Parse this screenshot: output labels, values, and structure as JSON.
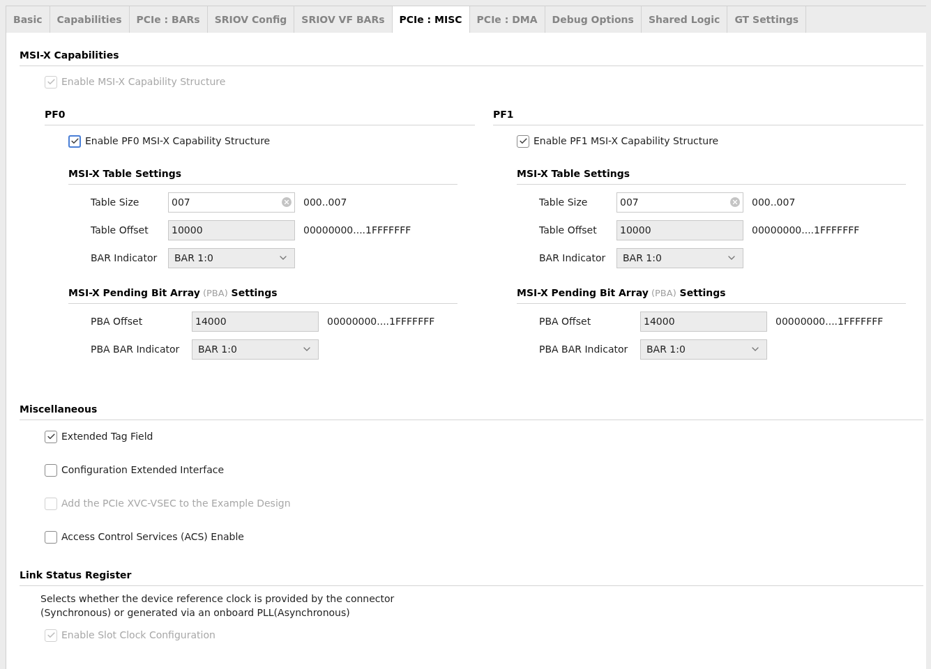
{
  "tabs": [
    {
      "label": "Basic",
      "selected": false
    },
    {
      "label": "Capabilities",
      "selected": false
    },
    {
      "label": "PCIe : BARs",
      "selected": false
    },
    {
      "label": "SRIOV Config",
      "selected": false
    },
    {
      "label": "SRIOV VF BARs",
      "selected": false
    },
    {
      "label": "PCIe : MISC",
      "selected": true
    },
    {
      "label": "PCIe : DMA",
      "selected": false
    },
    {
      "label": "Debug Options",
      "selected": false
    },
    {
      "label": "Shared Logic",
      "selected": false
    },
    {
      "label": "GT Settings",
      "selected": false
    }
  ],
  "msix": {
    "heading": "MSI-X Capabilities",
    "checkbox": {
      "label": "Enable MSI-X Capability Structure",
      "checked": true,
      "disabled": true
    },
    "functions": [
      {
        "heading": "PF0",
        "checkbox": {
          "label": "Enable PF0 MSI-X Capability Structure",
          "checked": true,
          "disabled": false,
          "focused": true
        },
        "table_heading": [
          {
            "text": "MSI-X Table Settings",
            "muted": false
          }
        ],
        "table_fields": [
          {
            "label": "Table Size",
            "kind": "text",
            "value": "007",
            "range": "000..007"
          },
          {
            "label": "Table Offset",
            "kind": "readonly",
            "value": "10000",
            "range": "00000000....1FFFFFFF"
          },
          {
            "label": "BAR Indicator",
            "kind": "select",
            "value": "BAR 1:0"
          }
        ],
        "pba_heading": [
          {
            "text": "MSI-X Pending Bit Array",
            "muted": false
          },
          {
            "text": "(PBA)",
            "muted": true
          },
          {
            "text": "Settings",
            "muted": false
          }
        ],
        "pba_fields": [
          {
            "label": "PBA Offset",
            "kind": "readonly",
            "value": "14000",
            "range": "00000000....1FFFFFFF"
          },
          {
            "label": "PBA BAR Indicator",
            "kind": "select",
            "value": "BAR 1:0"
          }
        ]
      },
      {
        "heading": "PF1",
        "checkbox": {
          "label": "Enable PF1 MSI-X Capability Structure",
          "checked": true,
          "disabled": false,
          "focused": false
        },
        "table_heading": [
          {
            "text": "MSI-X Table Settings",
            "muted": false
          }
        ],
        "table_fields": [
          {
            "label": "Table Size",
            "kind": "text",
            "value": "007",
            "range": "000..007"
          },
          {
            "label": "Table Offset",
            "kind": "readonly",
            "value": "10000",
            "range": "00000000....1FFFFFFF"
          },
          {
            "label": "BAR Indicator",
            "kind": "select",
            "value": "BAR 1:0"
          }
        ],
        "pba_heading": [
          {
            "text": "MSI-X Pending Bit Array",
            "muted": false
          },
          {
            "text": "(PBA)",
            "muted": true
          },
          {
            "text": "Settings",
            "muted": false
          }
        ],
        "pba_fields": [
          {
            "label": "PBA Offset",
            "kind": "readonly",
            "value": "14000",
            "range": "00000000....1FFFFFFF"
          },
          {
            "label": "PBA BAR Indicator",
            "kind": "select",
            "value": "BAR 1:0"
          }
        ]
      }
    ]
  },
  "misc": {
    "heading": "Miscellaneous",
    "checkboxes": [
      {
        "label": "Extended Tag Field",
        "checked": true,
        "disabled": false
      },
      {
        "label": "Configuration Extended Interface",
        "checked": false,
        "disabled": false
      },
      {
        "label": "Add the PCIe XVC-VSEC to the Example Design",
        "checked": false,
        "disabled": true
      },
      {
        "label": "Access Control Services (ACS) Enable",
        "checked": false,
        "disabled": false
      }
    ]
  },
  "link_status": {
    "heading": "Link Status Register",
    "description": [
      "Selects whether the device reference clock is provided by the connector",
      "(Synchronous) or generated via an onboard PLL(Asynchronous)"
    ],
    "checkbox": {
      "label": "Enable Slot Clock Configuration",
      "checked": true,
      "disabled": true
    }
  }
}
